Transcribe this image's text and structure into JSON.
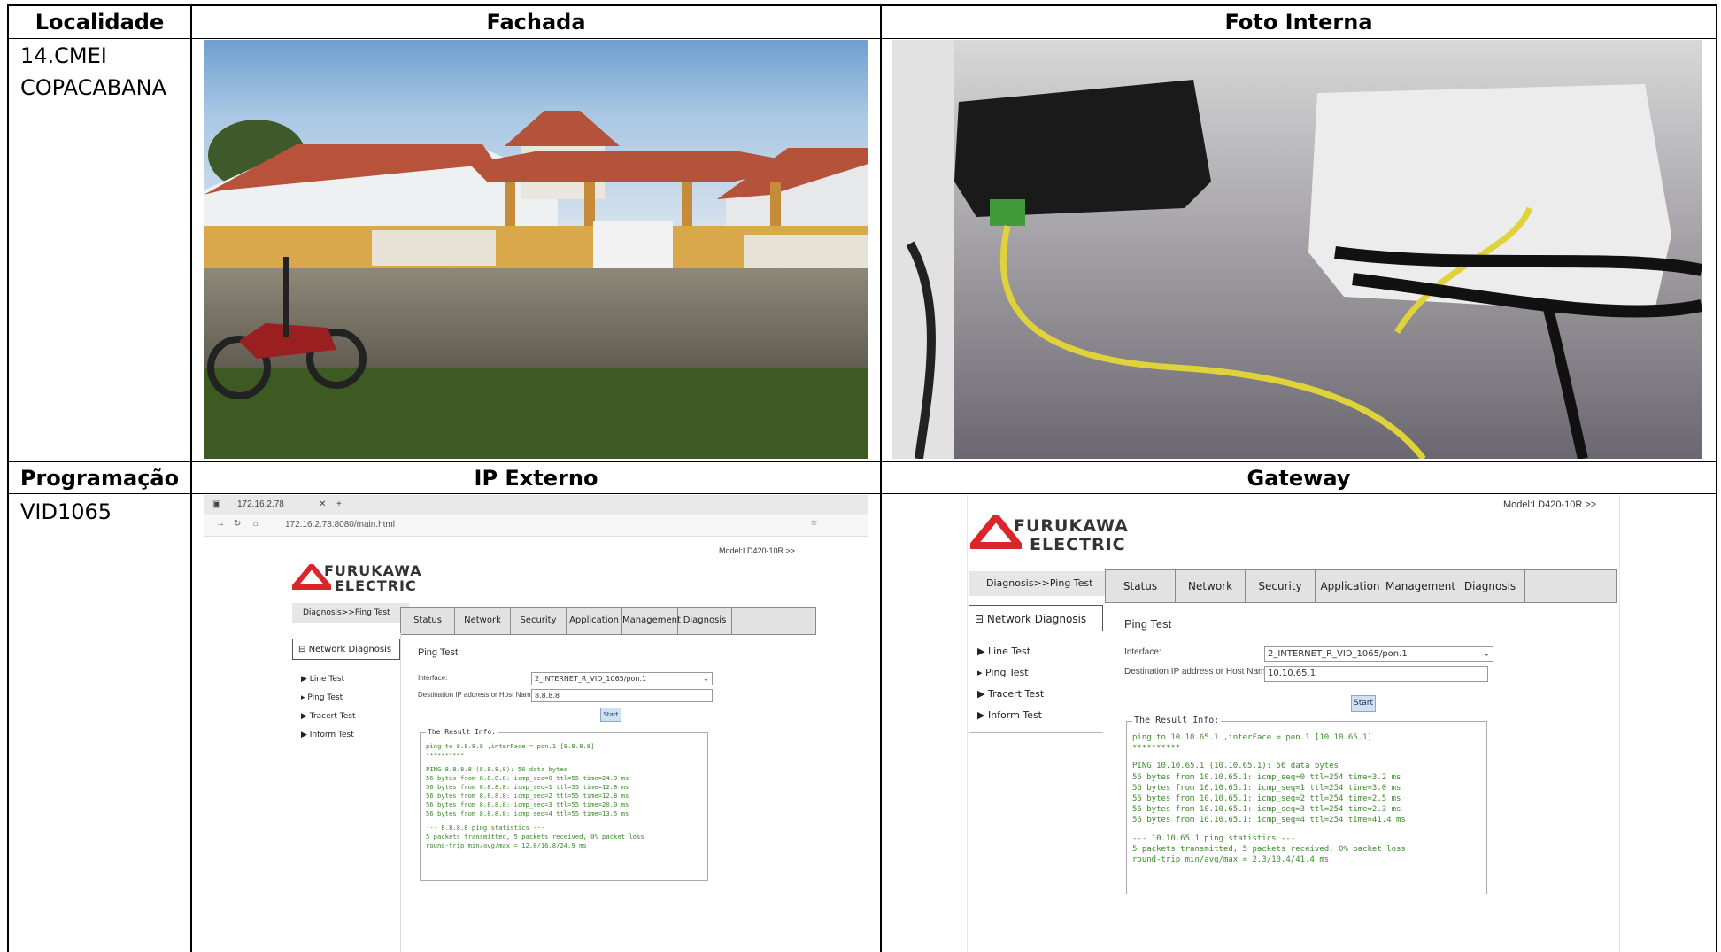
{
  "table": {
    "headers_row1": {
      "col1": "Localidade",
      "col2": "Fachada",
      "col3": "Foto Interna"
    },
    "headers_row2": {
      "col1": "Programação",
      "col2": "IP Externo",
      "col3": "Gateway"
    },
    "localidade_line1": "14.CMEI",
    "localidade_line2": "COPACABANA",
    "programacao": "VID1065"
  },
  "ip_externo": {
    "tab_title": "172.16.2.78",
    "url": "172.16.2.78:8080/main.html",
    "model": "Model:LD420-10R >>",
    "logo_line1": "FURUKAWA",
    "logo_line2": "ELECTRIC",
    "breadcrumb": "Diagnosis>>Ping Test",
    "menu": [
      "Status",
      "Network",
      "Security",
      "Application",
      "Management",
      "Diagnosis"
    ],
    "side_header": "Network Diagnosis",
    "side_items": [
      "Line Test",
      "Ping Test",
      "Tracert Test",
      "Inform Test"
    ],
    "page_title": "Ping Test",
    "interface_label": "Interface:",
    "interface_value": "2_INTERNET_R_VID_1065/pon.1",
    "dest_label": "Destination IP address or Host Name:",
    "dest_value": "8.8.8.8",
    "start": "Start",
    "result_title": "The Result Info:",
    "result_lines": [
      "ping to 8.8.8.8 ,interFace = pon.1 [8.8.8.8]",
      "**********",
      "",
      "PING 8.8.8.8 (8.8.8.8): 56 data bytes",
      "56 bytes from 8.8.8.8: icmp_seq=0 ttl=55 time=24.9 ms",
      "56 bytes from 8.8.8.8: icmp_seq=1 ttl=55 time=12.8 ms",
      "56 bytes from 8.8.8.8: icmp_seq=2 ttl=55 time=12.8 ms",
      "56 bytes from 8.8.8.8: icmp_seq=3 ttl=55 time=20.0 ms",
      "56 bytes from 8.8.8.8: icmp_seq=4 ttl=55 time=13.5 ms",
      "",
      "--- 8.8.8.8 ping statistics ---",
      "5 packets transmitted, 5 packets received, 0% packet loss",
      "round-trip min/avg/max = 12.8/16.8/24.9 ms"
    ]
  },
  "gateway": {
    "model": "Model:LD420-10R >>",
    "logo_line1": "FURUKAWA",
    "logo_line2": "ELECTRIC",
    "breadcrumb": "Diagnosis>>Ping Test",
    "menu": [
      "Status",
      "Network",
      "Security",
      "Application",
      "Management",
      "Diagnosis"
    ],
    "side_header": "Network Diagnosis",
    "side_items": [
      "Line Test",
      "Ping Test",
      "Tracert Test",
      "Inform Test"
    ],
    "page_title": "Ping Test",
    "interface_label": "Interface:",
    "interface_value": "2_INTERNET_R_VID_1065/pon.1",
    "dest_label": "Destination IP address or Host Name:",
    "dest_value": "10.10.65.1",
    "start": "Start",
    "result_title": "The Result Info:",
    "result_lines": [
      "ping to 10.10.65.1 ,interFace = pon.1 [10.10.65.1]",
      "**********",
      "",
      "PING 10.10.65.1 (10.10.65.1): 56 data bytes",
      "56 bytes from 10.10.65.1: icmp_seq=0 ttl=254 time=3.2 ms",
      "56 bytes from 10.10.65.1: icmp_seq=1 ttl=254 time=3.0 ms",
      "56 bytes from 10.10.65.1: icmp_seq=2 ttl=254 time=2.5 ms",
      "56 bytes from 10.10.65.1: icmp_seq=3 ttl=254 time=2.3 ms",
      "56 bytes from 10.10.65.1: icmp_seq=4 ttl=254 time=41.4 ms",
      "",
      "--- 10.10.65.1 ping statistics ---",
      "5 packets transmitted, 5 packets received, 0% packet loss",
      "round-trip min/avg/max = 2.3/10.4/41.4 ms"
    ]
  },
  "colors": {
    "border": "#000000",
    "logo_red": "#d9262b",
    "result_green": "#3a8b2a"
  }
}
